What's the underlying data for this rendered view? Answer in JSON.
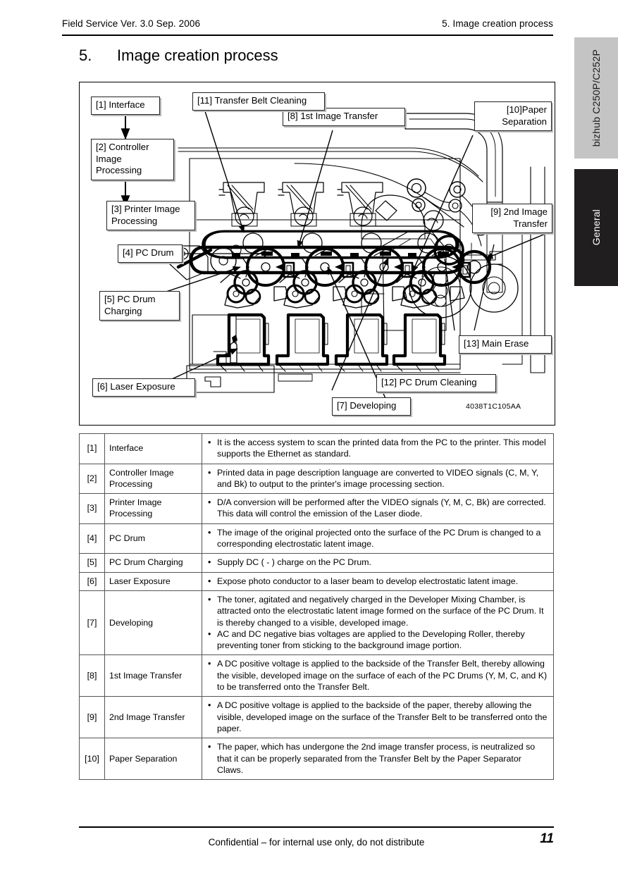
{
  "header": {
    "left": "Field Service Ver. 3.0 Sep. 2006",
    "right": "5. Image creation process"
  },
  "section": {
    "number": "5.",
    "title": "Image creation process"
  },
  "figure": {
    "id": "4038T1C105AA",
    "callouts": [
      {
        "key": "c1",
        "text": "[1] Interface"
      },
      {
        "key": "c2",
        "text": "[2] Controller\n     Image\n     Processing"
      },
      {
        "key": "c3",
        "text": "[3] Printer Image\n      Processing"
      },
      {
        "key": "c4",
        "text": "[4] PC Drum"
      },
      {
        "key": "c5",
        "text": "[5] PC Drum\n      Charging"
      },
      {
        "key": "c6",
        "text": "[6] Laser Exposure"
      },
      {
        "key": "c7",
        "text": "[7] Developing"
      },
      {
        "key": "c8",
        "text": "[8] 1st Image Transfer"
      },
      {
        "key": "c9",
        "text": "[9] 2nd Image\n      Transfer"
      },
      {
        "key": "c10",
        "text": "[10]Paper\nSeparation"
      },
      {
        "key": "c11",
        "text": "[11] Transfer Belt Cleaning"
      },
      {
        "key": "c12",
        "text": "[12] PC Drum Cleaning"
      },
      {
        "key": "c13",
        "text": "[13] Main Erase"
      }
    ]
  },
  "table": {
    "rows": [
      {
        "num": "[1]",
        "name": "Interface",
        "desc": [
          "It is the access system to scan the printed data from the PC to the printer. This model supports the Ethernet as standard."
        ]
      },
      {
        "num": "[2]",
        "name": "Controller Image Processing",
        "desc": [
          "Printed data in page description language are converted to VIDEO signals (C, M, Y, and Bk) to output to the printer's image processing section."
        ]
      },
      {
        "num": "[3]",
        "name": "Printer Image Processing",
        "desc": [
          "D/A conversion will be performed after the VIDEO signals (Y, M, C, Bk) are corrected. This data will control the emission of the Laser diode."
        ]
      },
      {
        "num": "[4]",
        "name": "PC Drum",
        "desc": [
          "The image of the original projected onto the surface of the PC Drum is changed to a corresponding electrostatic latent image."
        ]
      },
      {
        "num": "[5]",
        "name": "PC Drum Charging",
        "desc": [
          "Supply DC ( - ) charge on the PC Drum."
        ]
      },
      {
        "num": "[6]",
        "name": "Laser Exposure",
        "desc": [
          "Expose photo conductor to a laser beam to develop electrostatic latent image."
        ]
      },
      {
        "num": "[7]",
        "name": "Developing",
        "desc": [
          "The toner, agitated and negatively charged in the Developer Mixing Chamber, is attracted onto the electrostatic latent image formed on the surface of the PC Drum. It is thereby changed to a visible, developed image.",
          "AC and DC negative bias voltages are applied to the Developing Roller, thereby preventing toner from sticking to the background image portion."
        ]
      },
      {
        "num": "[8]",
        "name": "1st Image Transfer",
        "desc": [
          "A DC positive voltage is applied to the backside of the Transfer Belt, thereby allowing the visible, developed image on the surface of each of the PC Drums (Y, M, C, and K) to be transferred onto the Transfer Belt."
        ]
      },
      {
        "num": "[9]",
        "name": "2nd Image Transfer",
        "desc": [
          "A DC positive voltage is applied to the backside of the paper, thereby allowing the visible, developed image on the surface of the Transfer Belt to be transferred onto the paper."
        ]
      },
      {
        "num": "[10]",
        "name": "Paper Separation",
        "desc": [
          "The paper, which has undergone the 2nd image transfer process, is neutralized so that it can be properly separated from the Transfer Belt by the Paper Separator Claws."
        ]
      }
    ]
  },
  "side_tabs": {
    "product": "bizhub C250P/C252P",
    "section": "General"
  },
  "footer": {
    "notice": "Confidential – for internal use only, do not distribute",
    "page": "11"
  }
}
